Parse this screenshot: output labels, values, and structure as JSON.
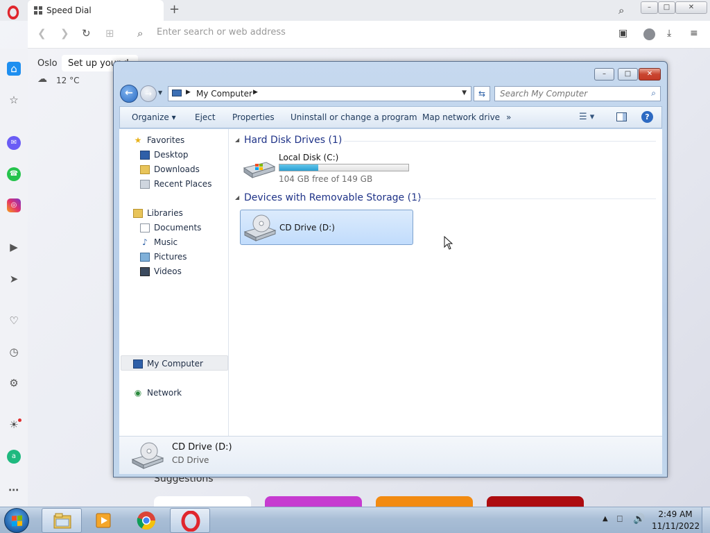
{
  "browser": {
    "tab_title": "Speed Dial",
    "new_tab": "+",
    "address_placeholder": "Enter search or web address",
    "accent_color": "#e0262d"
  },
  "speed_dial": {
    "weather_city": "Oslo",
    "weather_temp": "12 °C",
    "tooltip": "Set up your d",
    "suggestions_label": "Suggestions"
  },
  "explorer": {
    "address_location": "My Computer",
    "search_placeholder": "Search My Computer",
    "commands": {
      "organize": "Organize ▾",
      "eject": "Eject",
      "properties": "Properties",
      "uninstall": "Uninstall or change a program",
      "map_drive": "Map network drive",
      "more": "»"
    },
    "nav": {
      "favorites": "Favorites",
      "desktop": "Desktop",
      "downloads": "Downloads",
      "recent_places": "Recent Places",
      "libraries": "Libraries",
      "documents": "Documents",
      "music": "Music",
      "pictures": "Pictures",
      "videos": "Videos",
      "my_computer": "My Computer",
      "network": "Network"
    },
    "groups": {
      "hdd_header": "Hard Disk Drives (1)",
      "removable_header": "Devices with Removable Storage (1)"
    },
    "drive_c": {
      "label": "Local Disk (C:)",
      "free_text": "104 GB free of 149 GB",
      "used_fraction": 0.302
    },
    "drive_d": {
      "label": "CD Drive (D:)"
    },
    "details": {
      "name": "CD Drive (D:)",
      "type": "CD Drive"
    }
  },
  "taskbar": {
    "time": "2:49 AM",
    "date": "11/11/2022"
  }
}
